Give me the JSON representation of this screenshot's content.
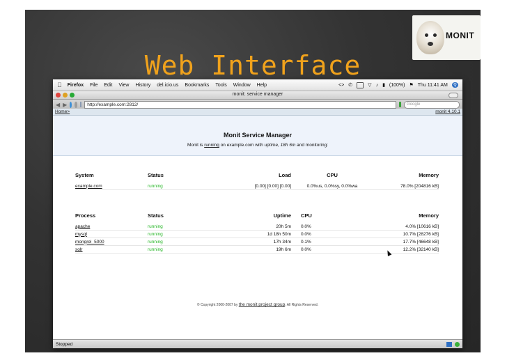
{
  "slide": {
    "title": "Web Interface",
    "logo_text": "MONIT"
  },
  "menubar": {
    "items": [
      "Firefox",
      "File",
      "Edit",
      "View",
      "History",
      "del.icio.us",
      "Bookmarks",
      "Tools",
      "Window",
      "Help"
    ],
    "battery": "(100%)",
    "clock": "Thu 11:41 AM"
  },
  "window": {
    "title": "monit: service manager"
  },
  "toolbar": {
    "url": "http://example.com:2812/",
    "search_placeholder": "Google"
  },
  "nav": {
    "home": "Home",
    "home_sep": ">",
    "version": "monit 4.10.1"
  },
  "header": {
    "title": "Monit Service Manager",
    "sub_pre": "Monit is ",
    "sub_state": "running",
    "sub_mid": " on example.com with ",
    "sub_uptime_label": "uptime, 18h 6m",
    "sub_post": " and monitoring:"
  },
  "system_table": {
    "headers": [
      "System",
      "Status",
      "Load",
      "CPU",
      "Memory"
    ],
    "rows": [
      [
        "example.com",
        "running",
        "[0.00] [0.00] [0.00]",
        "0.0%us, 0.0%sy, 0.0%wa",
        "78.0% [204816 kB]"
      ]
    ]
  },
  "process_table": {
    "headers": [
      "Process",
      "Status",
      "Uptime",
      "CPU",
      "Memory"
    ],
    "rows": [
      [
        "apache",
        "running",
        "20h 5m",
        "0.0%",
        "4.0% [10616 kB]"
      ],
      [
        "mysql",
        "running",
        "1d 18h 50m",
        "0.0%",
        "10.7% [28276 kB]"
      ],
      [
        "mongrel_5000",
        "running",
        "17h 34m",
        "0.1%",
        "17.7% [46648 kB]"
      ],
      [
        "solr",
        "running",
        "19h 6m",
        "0.0%",
        "12.2% [32140 kB]"
      ]
    ]
  },
  "footer": {
    "pre": "© Copyright 2000-2007 by ",
    "link": "the monit project group",
    "post": ". All Rights Reserved."
  },
  "statusbar": {
    "text": "Stopped"
  },
  "colors": {
    "accent": "#f0a21c",
    "running": "#22b522"
  }
}
